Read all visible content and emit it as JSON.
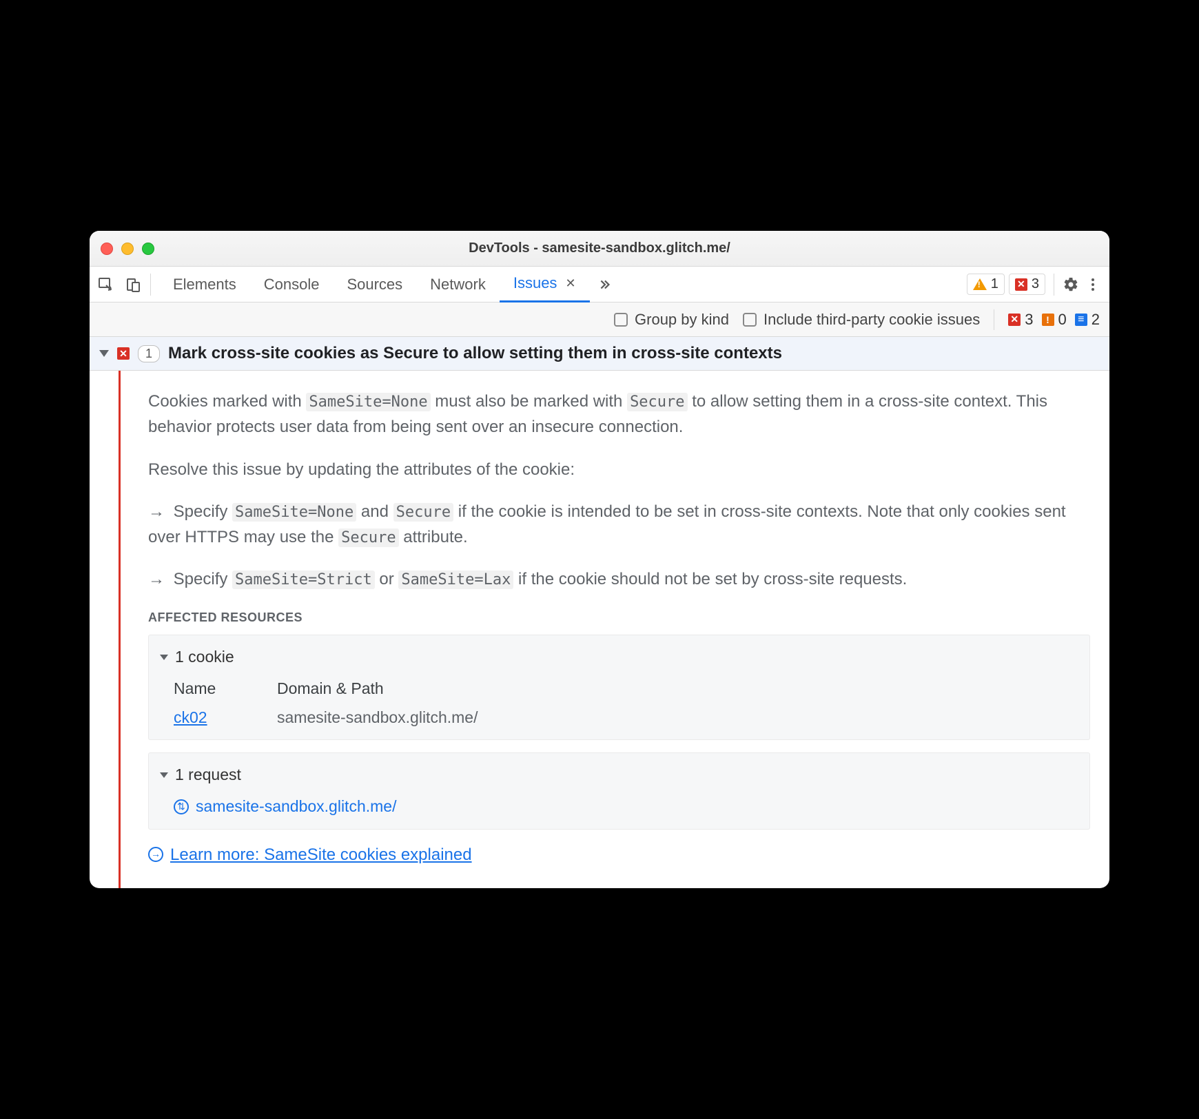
{
  "window": {
    "title": "DevTools - samesite-sandbox.glitch.me/"
  },
  "tabs": {
    "elements": "Elements",
    "console": "Console",
    "sources": "Sources",
    "network": "Network",
    "issues": "Issues"
  },
  "toolbar_badges": {
    "warnings": "1",
    "errors": "3"
  },
  "filter": {
    "group": "Group by kind",
    "thirdparty": "Include third-party cookie issues",
    "err": "3",
    "warn": "0",
    "info": "2"
  },
  "issue": {
    "count": "1",
    "title": "Mark cross-site cookies as Secure to allow setting them in cross-site contexts",
    "p1a": "Cookies marked with ",
    "p1_code1": "SameSite=None",
    "p1b": " must also be marked with ",
    "p1_code2": "Secure",
    "p1c": " to allow setting them in a cross-site context. This behavior protects user data from being sent over an insecure connection.",
    "p2": "Resolve this issue by updating the attributes of the cookie:",
    "b1a": "Specify ",
    "b1_code1": "SameSite=None",
    "b1b": " and ",
    "b1_code2": "Secure",
    "b1c": " if the cookie is intended to be set in cross-site contexts. Note that only cookies sent over HTTPS may use the ",
    "b1_code3": "Secure",
    "b1d": " attribute.",
    "b2a": "Specify ",
    "b2_code1": "SameSite=Strict",
    "b2b": " or ",
    "b2_code2": "SameSite=Lax",
    "b2c": " if the cookie should not be set by cross-site requests.",
    "affected_label": "AFFECTED RESOURCES",
    "cookies_header": "1 cookie",
    "col_name": "Name",
    "col_domain": "Domain & Path",
    "cookie_name": "ck02",
    "cookie_domain": "samesite-sandbox.glitch.me/",
    "requests_header": "1 request",
    "request_url": "samesite-sandbox.glitch.me/",
    "learn_more": "Learn more: SameSite cookies explained"
  }
}
